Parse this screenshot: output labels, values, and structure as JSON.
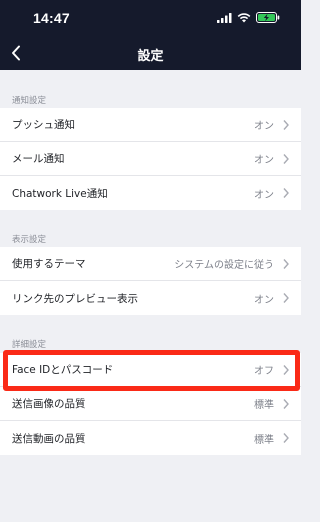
{
  "status": {
    "time": "14:47"
  },
  "nav": {
    "title": "設定"
  },
  "sections": [
    {
      "header": "通知設定",
      "rows": [
        {
          "label": "プッシュ通知",
          "value": "オン"
        },
        {
          "label": "メール通知",
          "value": "オン"
        },
        {
          "label": "Chatwork Live通知",
          "value": "オン"
        }
      ]
    },
    {
      "header": "表示設定",
      "rows": [
        {
          "label": "使用するテーマ",
          "value": "システムの設定に従う"
        },
        {
          "label": "リンク先のプレビュー表示",
          "value": "オン"
        }
      ]
    },
    {
      "header": "詳細設定",
      "rows": [
        {
          "label": "Face IDとパスコード",
          "value": "オフ"
        },
        {
          "label": "送信画像の品質",
          "value": "標準"
        },
        {
          "label": "送信動画の品質",
          "value": "標準"
        }
      ]
    }
  ],
  "highlight_color": "#fa2a17",
  "icons": [
    "signal-icon",
    "wifi-icon",
    "battery-charging-icon",
    "back-chevron-icon",
    "chevron-right-icon"
  ]
}
